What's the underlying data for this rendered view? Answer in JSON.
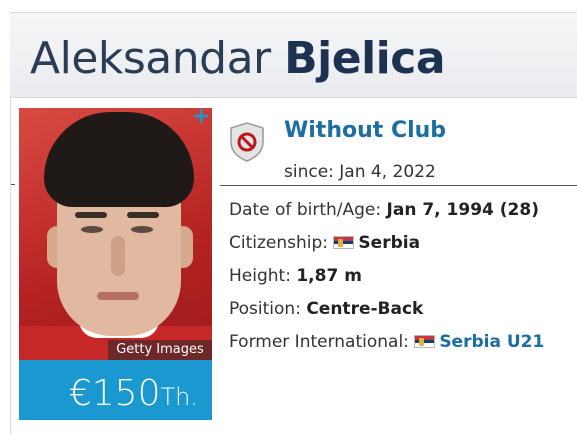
{
  "player": {
    "first_name": "Aleksandar",
    "last_name": "Bjelica"
  },
  "photo": {
    "credit": "Getty Images",
    "expand_icon": "plus-icon"
  },
  "market_value": {
    "amount": "€150",
    "unit": "Th."
  },
  "club": {
    "name": "Without Club",
    "since": "since: Jan 4, 2022",
    "icon": "no-club-shield-icon"
  },
  "details": {
    "dob_label": "Date of birth/Age:",
    "dob_value": "Jan 7, 1994 (28)",
    "citizenship_label": "Citizenship:",
    "citizenship_value": "Serbia",
    "height_label": "Height:",
    "height_value": "1,87 m",
    "position_label": "Position:",
    "position_value": "Centre-Back",
    "international_label": "Former International:",
    "international_value": "Serbia U21"
  },
  "colors": {
    "accent_blue": "#1a98d0",
    "link_blue": "#1a6ea1",
    "title_navy": "#1d3150",
    "shield_red": "#c0161c"
  }
}
